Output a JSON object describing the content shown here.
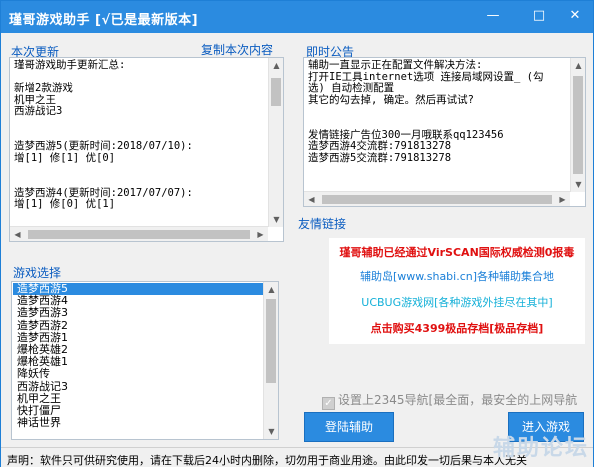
{
  "window": {
    "title": "瑾哥游戏助手 [√已是最新版本]",
    "min_label": "—",
    "max_label": "□",
    "close_label": "✕"
  },
  "update_panel": {
    "label": "本次更新",
    "copy_link": "复制本次内容",
    "content": "瑾哥游戏助手更新汇总:\n\n新增2款游戏\n机甲之王\n西游战记3\n\n\n造梦西游5(更新时间:2018/07/10):\n增[1] 修[1] 优[0]\n\n\n造梦西游4(更新时间:2017/07/07):\n增[1] 修[0] 优[1]"
  },
  "notice_panel": {
    "label": "即时公告",
    "content": "辅助一直显示正在配置文件解决方法:\n打开IE工具internet选项 连接局域网设置_ (勾\n选) 自动检测配置\n其它的勾去掉, 确定。然后再试试?\n\n\n发情链接广告位300一月哦联系qq123456\n造梦西游4交流群:791813278\n造梦西游5交流群:791813278"
  },
  "friend_links": {
    "label": "友情链接",
    "lines": [
      {
        "text": "瑾哥辅助已经通过VirSCAN国际权威检测0报毒",
        "color": "#e01010",
        "bold": true
      },
      {
        "text": "辅助岛[www.shabi.cn]各种辅助集合地",
        "color": "#1a7fd8",
        "bold": false
      },
      {
        "text": "UCBUG游戏网[各种游戏外挂尽在其中]",
        "color": "#14b0d8",
        "bold": false
      },
      {
        "text": "点击购买4399极品存档[极品存档]",
        "color": "#e01010",
        "bold": true
      }
    ]
  },
  "game_list": {
    "label": "游戏选择",
    "items": [
      "造梦西游5",
      "造梦西游4",
      "造梦西游3",
      "造梦西游2",
      "造梦西游1",
      "爆枪英雄2",
      "爆枪英雄1",
      "降妖传",
      "西游战记3",
      "机甲之王",
      "快打僵尸",
      "神话世界"
    ],
    "selected_index": 0
  },
  "options": {
    "homepage_checkbox": "设置上2345导航[最全面，最安全的上网导航",
    "checked": true
  },
  "buttons": {
    "login": "登陆辅助",
    "second": "进入游戏"
  },
  "status": {
    "text": "声明：软件只可供研究使用，请在下载后24小时内删除，切勿用于商业用途。由此印发一切后果与本人无关",
    "watermark": "辅助论坛"
  },
  "colors": {
    "accent": "#2b8be0",
    "link": "#0a5cc0"
  }
}
